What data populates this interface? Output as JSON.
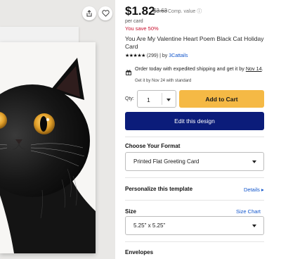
{
  "actions": {
    "share_icon": "share-icon",
    "favorite_icon": "heart-icon"
  },
  "product": {
    "price": "$1.82",
    "old_price": "$3.63",
    "comp_value": "Comp. value ⓘ",
    "per_unit": "per card",
    "savings": "You save 50%",
    "title": "You Are My Valentine Heart Poem Black Cat Holiday Card",
    "rating": {
      "stars": "★★★★★",
      "count": "(299)",
      "by": "| by",
      "seller": "3Cattails"
    }
  },
  "shipping": {
    "icon": "gift-icon",
    "text_before": "Order today with expedited shipping and get it by",
    "date": "Nov 14",
    "text_after": ".",
    "standard": "Get it by Nov 24 with standard"
  },
  "purchase": {
    "qty_label": "Qty:",
    "qty_value": "1",
    "add_to_cart": "Add to Cart",
    "edit_design": "Edit this design"
  },
  "format": {
    "label": "Choose Your Format",
    "selected": "Printed Flat Greeting Card"
  },
  "personalize": {
    "label": "Personalize this template",
    "details": "Details ▸"
  },
  "size": {
    "label": "Size",
    "chart_link": "Size Chart",
    "selected": "5.25\" x 5.25\""
  },
  "envelopes": {
    "label": "Envelopes"
  },
  "colors": {
    "accent_red": "#c8102e",
    "cart_yellow": "#f5b945",
    "edit_navy": "#0b1c7a",
    "link_blue": "#1155cc"
  }
}
